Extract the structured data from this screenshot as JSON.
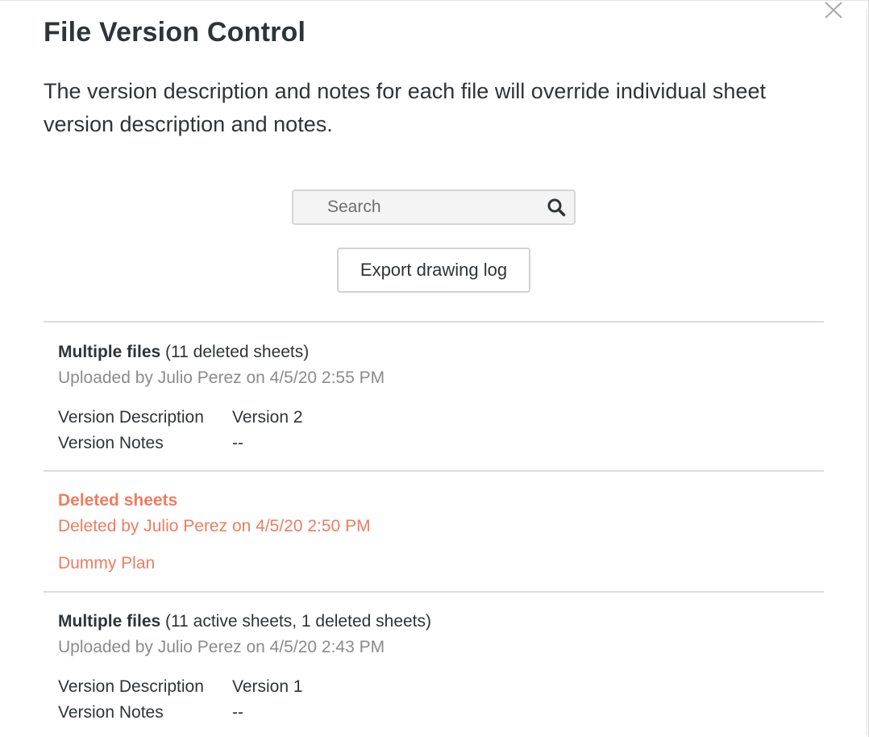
{
  "modal": {
    "title": "File Version Control",
    "subtitle": "The version description and notes for each file will override individual sheet version description and notes."
  },
  "search": {
    "placeholder": "Search",
    "value": ""
  },
  "export_button_label": "Export drawing log",
  "entries": [
    {
      "type": "upload",
      "title": "Multiple files",
      "count_text": "(11 deleted sheets)",
      "meta": "Uploaded by Julio Perez on 4/5/20 2:55 PM",
      "description_label": "Version Description",
      "description_value": "Version 2",
      "notes_label": "Version Notes",
      "notes_value": "--"
    },
    {
      "type": "deleted",
      "title": "Deleted sheets",
      "meta": "Deleted by Julio Perez on 4/5/20 2:50 PM",
      "file": "Dummy Plan"
    },
    {
      "type": "upload",
      "title": "Multiple files",
      "count_text": "(11 active sheets, 1 deleted sheets)",
      "meta": "Uploaded by Julio Perez on 4/5/20 2:43 PM",
      "description_label": "Version Description",
      "description_value": "Version 1",
      "notes_label": "Version Notes",
      "notes_value": "--"
    }
  ],
  "colors": {
    "text": "#2f3437",
    "muted": "#8b8b8b",
    "deleted": "#f07c5f",
    "divider": "#dcdcdc"
  },
  "icons": [
    "close-icon",
    "search-icon"
  ]
}
